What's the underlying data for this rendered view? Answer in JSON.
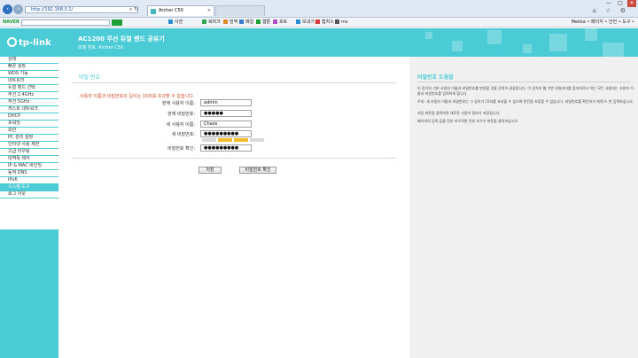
{
  "browser": {
    "address": "http://192.168.0.1/",
    "tab_title": "Archer C50",
    "tab_close": "×",
    "min": "—",
    "max": "□",
    "close": "✕",
    "right_icons": "⌂ ☆ ⚙"
  },
  "toolbar": {
    "naver": "NAVER",
    "items": [
      "사전",
      "북마크",
      "번역",
      "메일",
      "웹툰",
      "포토",
      "보내기",
      "캡처스",
      "ms"
    ],
    "right": "Mekka • 페이지 • 안전 • 도구 •"
  },
  "header": {
    "logo": "tp-link",
    "model_title": "AC1200 무선 듀얼 밴드 공유기",
    "model_sub": "모델 번호. Archer C50"
  },
  "sidebar": {
    "items": [
      "상태",
      "빠른 설정",
      "WDS 기능",
      "네트워크",
      "듀얼 밴드 선택",
      "무선 2.4GHz",
      "무선 5GHz",
      "게스트 네트워크",
      "DHCP",
      "포워딩",
      "보안",
      "PC 관리 설정",
      "인터넷 사용 제한",
      "고급 라우팅",
      "대역폭 제어",
      "IP & MAC 바인딩",
      "동적 DNS",
      "IPv6",
      "시스템 도구",
      "로그 아웃"
    ]
  },
  "main": {
    "title": "비밀 번호",
    "warning": "사용자 이름과 비밀번호의 길이는 15자를 초과할 수 없습니다.",
    "fields": [
      {
        "label": "현재 사용자 이름:",
        "value": "admin"
      },
      {
        "label": "현재 비밀번호:",
        "value": "●●●●●"
      },
      {
        "label": "새 사용자 이름:",
        "value": "Chaos"
      },
      {
        "label": "새 비밀번호:",
        "value": "●●●●●●●●●"
      },
      {
        "label": "비밀번호 확인:",
        "value": "●●●●●●●●●"
      }
    ],
    "strength_level": 0.5,
    "save": "저장",
    "confirm": "비밀번호 확인"
  },
  "help": {
    "title": "비밀번호 도움말",
    "paragraphs": [
      "이 장치의 기본 사용자 이름과 비밀번호를 변경할 것을 강력히 권장합니다. 이 장치의 웹 기반 유틸리티를 접속하려고 하는 모든 사용자는 사용자 이름과 비밀번호를 입력하게 합니다.",
      "주의: 새 사용자 이름과 비밀번호는 그 길이가 15자를 초과할 수 없으며 빈칸을 포함할 수 없습니다. 비밀번호를 확인하기 위해 두 번 입력하십시오.",
      "저장 버튼을 클릭하면 새로운 사용자 정보가 저장됩니다.",
      "페이지의 입력 값을 전부 지우려면 전부 지우기 버튼을 클릭하십시오."
    ]
  },
  "colors": {
    "accent": "#4acbd6",
    "warning": "#d44a2a",
    "strength_on": "#f3bc27"
  }
}
